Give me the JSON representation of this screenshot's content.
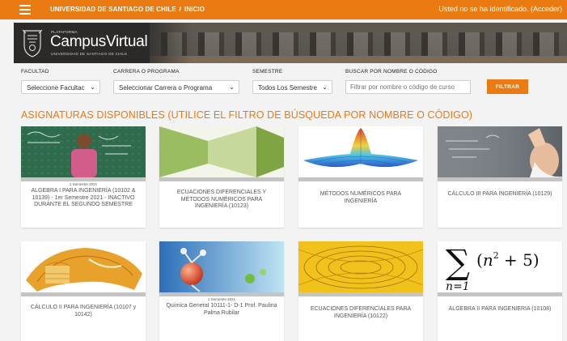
{
  "topbar": {
    "crumb_university": "UNIVERSIDAD DE SANTIAGO DE CHILE",
    "crumb_separator": "/",
    "crumb_home": "INICIO",
    "login_text": "Usted no se ha identificado. (Acceder)"
  },
  "banner": {
    "platform": "PLATAFORMA",
    "campus": "Campus",
    "virtual": "Virtual",
    "university": "UNIVERSIDAD DE SANTIAGO DE CHILE"
  },
  "filters": {
    "faculty_label": "FACULTAD",
    "faculty_value": "Seleccione Facultac",
    "career_label": "CARRERA O PROGRAMA",
    "career_value": "Seleccionar Carrera o Programa",
    "semester_label": "SEMESTRE",
    "semester_value": "Todos Los Semestre",
    "search_label": "BUSCAR POR NOMBRE O CÓDIGO",
    "search_placeholder": "Filtrar por nombre o código de curso",
    "filter_button": "FILTRAR"
  },
  "section_heading": "ASIGNATURAS DISPONIBLES (UTILICE EL FILTRO DE BÚSQUEDA POR NOMBRE O CÓDIGO)",
  "courses": [
    {
      "semester": "1 Semestre 2021",
      "title": "ALGEBRA I PARA INGENIERÍA (10102 & 10139) - 1er Semestre 2021 - INACTIVO DURANTE EL SEGUNDO SEMESTRE"
    },
    {
      "semester": "",
      "title": "ECUACIONES DIFERENCIALES Y MÉTODOS NUMÉRICOS PARA INGENIERÍA (10123)"
    },
    {
      "semester": "",
      "title": "MÉTODOS NUMÉRICOS PARA INGENIERÍA"
    },
    {
      "semester": "",
      "title": "CÁLCULO III PARA INGENIERÍA (10129)"
    },
    {
      "semester": "",
      "title": "CÁLCULO II PARA INGENIERÍA (10107 y 10142)"
    },
    {
      "semester": "1 Semestre 2021",
      "title": "Química General 10111-1- D-1 Prof. Paulina Palma Rubilar"
    },
    {
      "semester": "",
      "title": "ECUACIONES DIFERENCIALES PARA INGENIERÍA (10122)"
    },
    {
      "semester": "",
      "title": "ALGEBRA II PARA INGENIERIA (10108)"
    }
  ],
  "colors": {
    "accent": "#ea7b13",
    "banner_bg": "#2c2a28",
    "page_bg": "#f3f3f3",
    "card_strip": "#c4c4c4"
  },
  "icons": {
    "menu": "hamburger-menu-icon",
    "select": "chevron-down-icon"
  }
}
